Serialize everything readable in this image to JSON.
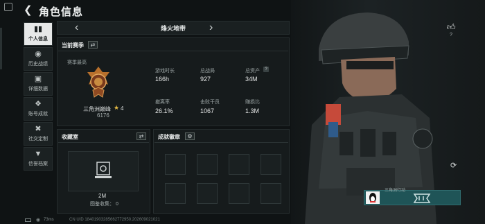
{
  "header": {
    "title": "角色信息"
  },
  "nav": {
    "items": [
      {
        "label": "个人信息",
        "icon": "bar-chart-icon",
        "active": true
      },
      {
        "label": "历史战绩",
        "icon": "history-icon",
        "active": false
      },
      {
        "label": "详细数据",
        "icon": "data-icon",
        "active": false
      },
      {
        "label": "账号成就",
        "icon": "achievement-icon",
        "active": false
      },
      {
        "label": "社交定制",
        "icon": "tools-icon",
        "active": false
      },
      {
        "label": "信誉档案",
        "icon": "shield-icon",
        "active": false
      }
    ]
  },
  "map_selector": {
    "current": "烽火地带"
  },
  "season": {
    "title": "当前赛季",
    "best_label": "赛季最高",
    "rank_name": "三角洲巅峰",
    "rank_level": "4",
    "rank_score": "6176",
    "stats": [
      {
        "label": "游戏时长",
        "value": "166h"
      },
      {
        "label": "总战局",
        "value": "927"
      },
      {
        "label": "总资产",
        "value": "34M",
        "help": "?"
      },
      {
        "label": "撤离率",
        "value": "26.1%"
      },
      {
        "label": "击败干员",
        "value": "1067"
      },
      {
        "label": "赚损比",
        "value": "1.3M"
      }
    ]
  },
  "collection": {
    "title": "收藏室",
    "count": "2M",
    "progress": "图鉴收集： 0"
  },
  "badges": {
    "title": "成就徽章"
  },
  "profile": {
    "likes": "?",
    "id_name": "三角洲行动"
  },
  "footer": {
    "ping": "73ms",
    "uid": "CN UID 18401903285662772950.202609021021"
  },
  "colors": {
    "accent": "#e2b844",
    "id_card": "#1f5457"
  }
}
